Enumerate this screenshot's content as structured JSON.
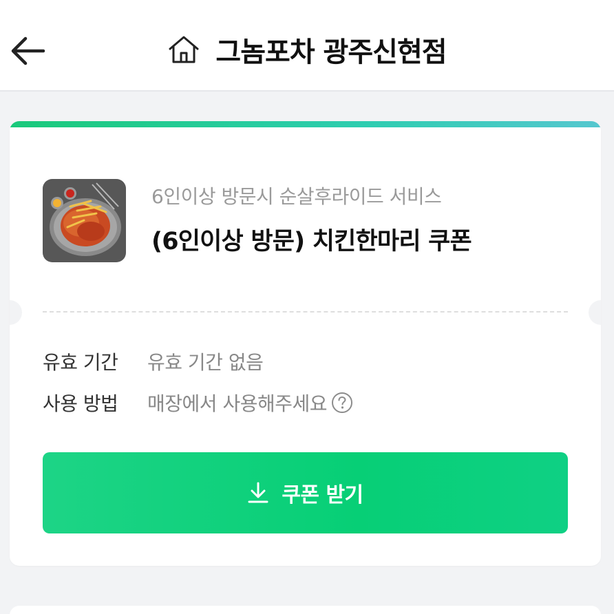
{
  "header": {
    "title": "그놈포차 광주신현점",
    "back_icon": "arrow-left-icon",
    "home_icon": "home-icon"
  },
  "coupon": {
    "subtitle": "6인이상 방문시 순살후라이드 서비스",
    "name": "(6인이상 방문) 치킨한마리 쿠폰",
    "thumbnail": "fried-chicken-photo",
    "validity_label": "유효 기간",
    "validity_value": "유효 기간 없음",
    "usage_label": "사용 방법",
    "usage_value": "매장에서 사용해주세요",
    "help_icon": "question-circle-icon",
    "download_label": "쿠폰 받기",
    "download_icon": "download-icon"
  },
  "colors": {
    "accent": "#07cf76",
    "topbar_start": "#19c97a",
    "topbar_end": "#55c7cf",
    "background": "#f2f3f5"
  }
}
